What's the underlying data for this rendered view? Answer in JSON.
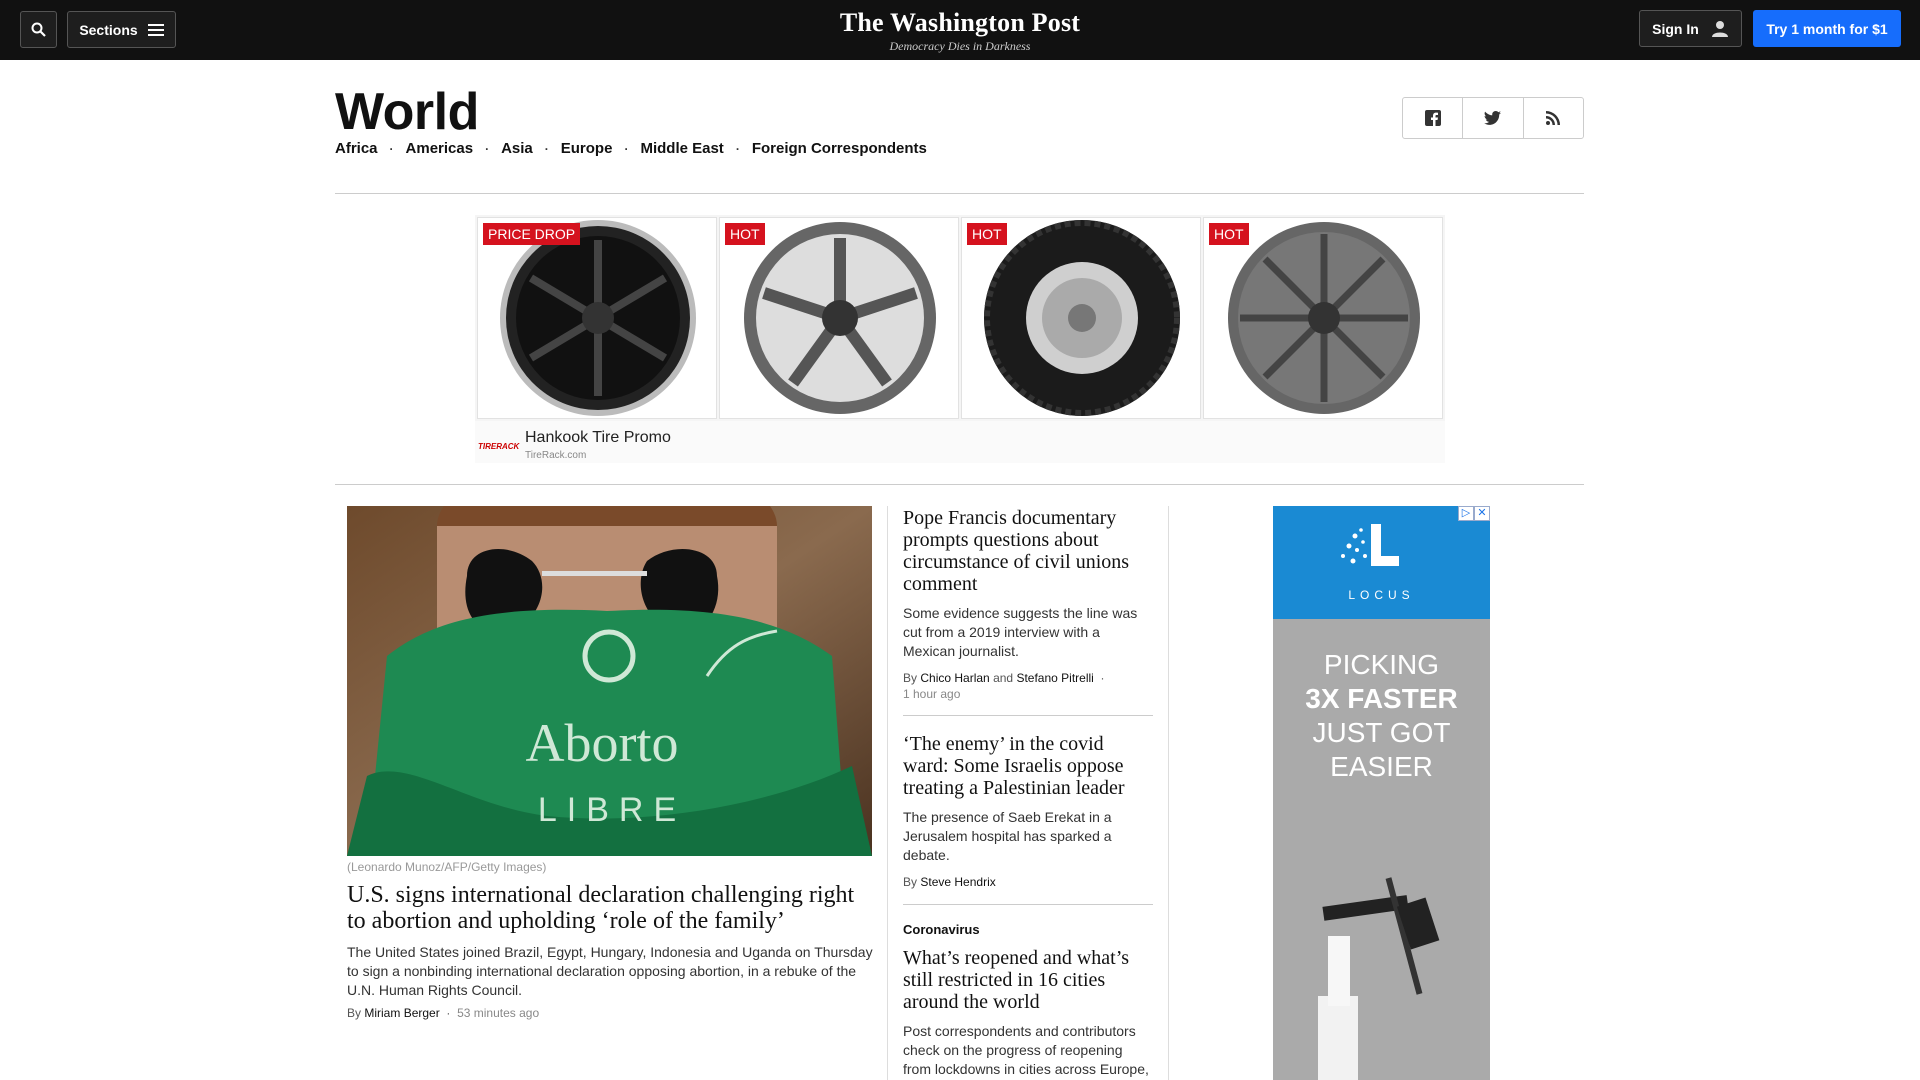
{
  "topbar": {
    "sections_label": "Sections",
    "logo_name": "The Washington Post",
    "logo_tagline": "Democracy Dies in Darkness",
    "signin_label": "Sign In",
    "try_label": "Try 1 month for $1",
    "icons": [
      "search-icon",
      "hamburger-icon",
      "user-icon"
    ]
  },
  "section": {
    "title": "World",
    "subnav": [
      "Africa",
      "Americas",
      "Asia",
      "Europe",
      "Middle East",
      "Foreign Correspondents"
    ],
    "share_icons": [
      "facebook-icon",
      "twitter-icon",
      "rss-icon"
    ]
  },
  "ad_banner": {
    "badges": [
      "PRICE DROP",
      "HOT",
      "HOT",
      "HOT"
    ],
    "brand_logo": "TIRERACK",
    "title": "Hankook Tire Promo",
    "url": "TireRack.com"
  },
  "lead": {
    "photo_text_1": "Aborto",
    "photo_text_2": "LIBRE",
    "caption": "(Leonardo Munoz/AFP/Getty Images)",
    "headline": "U.S. signs international declaration challenging right to abortion and upholding ‘role of the family’",
    "blurb": "The United States joined Brazil, Egypt, Hungary, Indonesia and Uganda on Thursday to sign a nonbinding international declaration opposing abortion, in a rebuke of the U.N. Human Rights Council.",
    "by": "By",
    "author": "Miriam Berger",
    "time": "53 minutes ago"
  },
  "stories": [
    {
      "headline": "Pope Francis documentary prompts questions about circumstance of civil unions comment",
      "blurb": "Some evidence suggests the line was cut from a 2019 interview with a Mexican journalist.",
      "by": "By",
      "author1": "Chico Harlan",
      "and": "and",
      "author2": "Stefano Pitrelli",
      "time": "1 hour ago"
    },
    {
      "headline": "‘The enemy’ in the covid ward: Some Israelis oppose treating a Palestinian leader",
      "blurb": "The presence of Saeb Erekat in a Jerusalem hospital has sparked a debate.",
      "by": "By",
      "author": "Steve Hendrix"
    },
    {
      "kicker": "Coronavirus",
      "headline": "What’s reopened and what’s still restricted in 16 cities around the world",
      "blurb": "Post correspondents and contributors check on the progress of reopening from lockdowns in cities across Europe,"
    }
  ],
  "right_ad": {
    "brand": "LOCUS",
    "line1": "PICKING",
    "line2": "3X FASTER",
    "line3": "JUST GOT",
    "line4": "EASIER",
    "close_label": "✕"
  }
}
